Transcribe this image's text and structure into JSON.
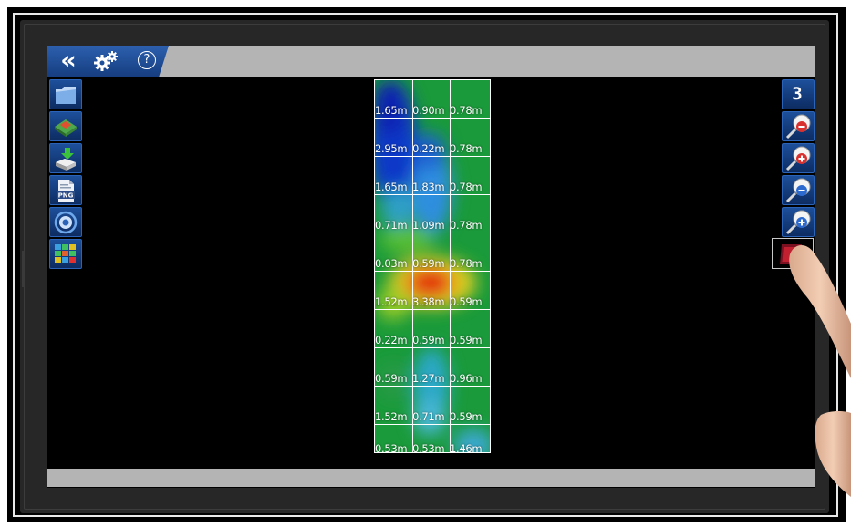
{
  "app": {
    "toolbar": {
      "back_glyph": "«",
      "help_glyph": "?"
    },
    "right_toolbar": {
      "view_3d_label": "3 D"
    },
    "heatmap": {
      "columns": 3,
      "rows": 10,
      "values": [
        [
          "1.65m",
          "0.90m",
          "0.78m"
        ],
        [
          "2.95m",
          "0.22m",
          "0.78m"
        ],
        [
          "1.65m",
          "1.83m",
          "0.78m"
        ],
        [
          "0.71m",
          "1.09m",
          "0.78m"
        ],
        [
          "0.03m",
          "0.59m",
          "0.78m"
        ],
        [
          "1.52m",
          "3.38m",
          "0.59m"
        ],
        [
          "0.22m",
          "0.59m",
          "0.59m"
        ],
        [
          "0.59m",
          "1.27m",
          "0.96m"
        ],
        [
          "1.52m",
          "0.71m",
          "0.59m"
        ],
        [
          "0.53m",
          "0.53m",
          "1.46m"
        ]
      ]
    },
    "colors": {
      "toolbar_blue": "#1d4f9a",
      "bar_grey": "#b4b4b4",
      "heat_low": "#1040c8",
      "heat_mid": "#1a9a3a",
      "heat_high": "#e01010"
    }
  }
}
